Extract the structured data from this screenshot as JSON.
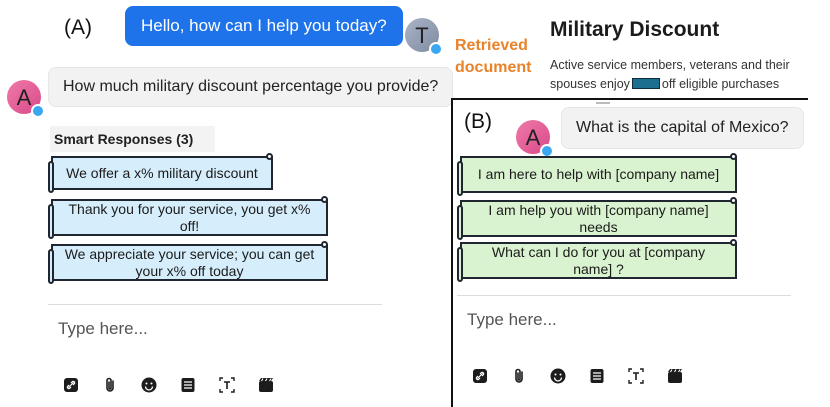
{
  "panel_a": {
    "label": "(A)",
    "user_greeting": "Hello, how can I help you today?",
    "user_avatar_letter": "T",
    "question": "How much military discount percentage you provide?",
    "question_avatar_letter": "A",
    "smart_header": "Smart Responses (3)",
    "responses": [
      "We offer a x% military discount",
      "Thank you for your service, you get x% off!",
      "We appreciate your service; you can get your x% off today"
    ],
    "input_placeholder": "Type here..."
  },
  "retrieved": {
    "label_line1": "Retrieved",
    "label_line2": "document",
    "title": "Military Discount",
    "body_line1": "Active service members, veterans and their",
    "body_line2_pre": "spouses enjoy",
    "body_line2_post": "off eligible purchases"
  },
  "panel_b": {
    "label": "(B)",
    "question": "What is the capital of Mexico?",
    "question_avatar_letter": "A",
    "responses": [
      "I am here to help with [company name]",
      "I am help you with [company name] needs",
      "What can I do for you at [company name] ?"
    ],
    "input_placeholder": "Type here..."
  },
  "toolbar_icons": [
    "link-icon",
    "paperclip-icon",
    "emoji-icon",
    "document-icon",
    "text-format-icon",
    "media-icon"
  ],
  "colors": {
    "user_bubble": "#1e73ea",
    "chip_blue": "#d6eefc",
    "chip_green": "#d9f2cf",
    "retrieved_label": "#e8832b",
    "redaction": "#1d6f8f"
  }
}
